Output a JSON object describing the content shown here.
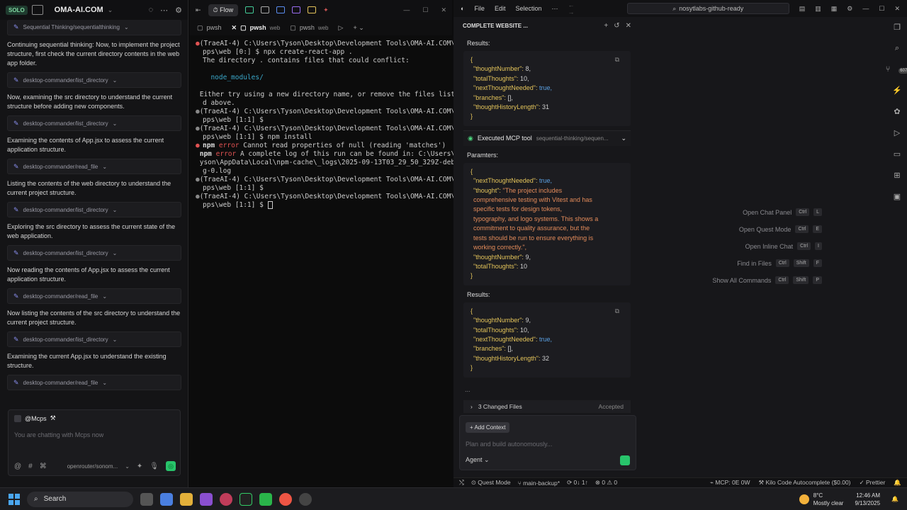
{
  "left": {
    "app_title": "OMA-AI.COM",
    "badge": "SOLO",
    "top_item": "Sequential Thinking/sequentialthinking",
    "entries": [
      {
        "text": "Continuing sequential thinking: Now, to implement the project structure, first check the current directory contents in the web app folder.",
        "tool": "desktop-commander/list_directory"
      },
      {
        "text": "Now, examining the src directory to understand the current structure before adding new components.",
        "tool": "desktop-commander/list_directory"
      },
      {
        "text": "Examining the contents of App.jsx to assess the current application structure.",
        "tool": "desktop-commander/read_file"
      },
      {
        "text": "Listing the contents of the web directory to understand the current project structure.",
        "tool": "desktop-commander/list_directory"
      },
      {
        "text": "Exploring the src directory to assess the current state of the web application.",
        "tool": "desktop-commander/list_directory"
      },
      {
        "text": "Now reading the contents of App.jsx to assess the current application structure.",
        "tool": "desktop-commander/read_file"
      },
      {
        "text": "Now listing the contents of the src directory to understand the current project structure.",
        "tool": "desktop-commander/list_directory"
      },
      {
        "text": "Examining the current App.jsx to understand the existing structure.",
        "tool": "desktop-commander/read_file"
      }
    ],
    "chat": {
      "mention": "@Mcps",
      "placeholder": "You are chatting with Mcps now",
      "model": "openrouter/sonom..."
    }
  },
  "terminal": {
    "flow_label": "Flow",
    "tabs": [
      {
        "name": "pwsh",
        "sub": ""
      },
      {
        "name": "pwsh",
        "sub": "web"
      },
      {
        "name": "pwsh",
        "sub": "web"
      }
    ],
    "lines": [
      {
        "dot": "red",
        "text": "(TraeAI-4) C:\\Users\\Tyson\\Desktop\\Development Tools\\OMA-AI.COM\\a"
      },
      {
        "dot": "",
        "text": "pps\\web [0:] $ npx create-react-app ."
      },
      {
        "dot": "",
        "text": "The directory . contains files that could conflict:"
      },
      {
        "dot": "",
        "text": ""
      },
      {
        "dot": "",
        "text": "  node_modules/",
        "cls": "cyan"
      },
      {
        "dot": "",
        "text": ""
      },
      {
        "dot": "",
        "text": "Either try using a new directory name, or remove the files liste"
      },
      {
        "dot": "",
        "text": "d above."
      },
      {
        "dot": "grey",
        "text": "(TraeAI-4) C:\\Users\\Tyson\\Desktop\\Development Tools\\OMA-AI.COM\\a"
      },
      {
        "dot": "",
        "text": "pps\\web [1:1] $"
      },
      {
        "dot": "grey",
        "text": "(TraeAI-4) C:\\Users\\Tyson\\Desktop\\Development Tools\\OMA-AI.COM\\a"
      },
      {
        "dot": "",
        "text": "pps\\web [1:1] $ npm install"
      },
      {
        "dot": "red",
        "text": "npm error Cannot read properties of null (reading 'matches')",
        "cls": "errline"
      },
      {
        "dot": "",
        "text": "npm error A complete log of this run can be found in: C:\\Users\\T",
        "cls": "errline"
      },
      {
        "dot": "",
        "text": "yson\\AppData\\Local\\npm-cache\\_logs\\2025-09-13T03_29_50_329Z-debu"
      },
      {
        "dot": "",
        "text": "g-0.log"
      },
      {
        "dot": "grey",
        "text": "(TraeAI-4) C:\\Users\\Tyson\\Desktop\\Development Tools\\OMA-AI.COM\\a"
      },
      {
        "dot": "",
        "text": "pps\\web [1:1] $"
      },
      {
        "dot": "grey",
        "text": "(TraeAI-4) C:\\Users\\Tyson\\Desktop\\Development Tools\\OMA-AI.COM\\a"
      },
      {
        "dot": "",
        "text": "pps\\web [1:1] $ ",
        "cursor": true
      }
    ]
  },
  "editor": {
    "menus": [
      "File",
      "Edit",
      "Selection",
      "···"
    ],
    "search": "nosytlabs-github-ready",
    "chat_title": "COMPLETE WEBSITE ...",
    "results_label": "Results:",
    "params_label": "Paramters:",
    "exec_label": "Executed MCP tool",
    "exec_tool": "sequential-thinking/sequen...",
    "changed_files": "3 Changed Files",
    "accepted": "Accepted",
    "add_context": "Add Context",
    "input_placeholder": "Plan and build autonomously...",
    "agent": "Agent",
    "ellipsis": "...",
    "results1": [
      [
        "\"thoughtNumber\": ",
        "8,",
        "num"
      ],
      [
        "\"totalThoughts\": ",
        "10,",
        "num"
      ],
      [
        "\"nextThoughtNeeded\": ",
        "true,",
        "bool"
      ],
      [
        "\"branches\": ",
        "[],",
        "num"
      ],
      [
        "\"thoughtHistoryLength\": ",
        "31",
        "num"
      ]
    ],
    "params": [
      [
        "\"nextThoughtNeeded\": ",
        "true,",
        "bool"
      ],
      [
        "\"thought\": ",
        "\"The project includes",
        "str"
      ],
      [
        "",
        "comprehensive testing with Vitest and has",
        "str"
      ],
      [
        "",
        "specific tests for design tokens,",
        "str"
      ],
      [
        "",
        "typography, and logo systems. This shows a",
        "str"
      ],
      [
        "",
        "commitment to quality assurance, but the",
        "str"
      ],
      [
        "",
        "tests should be run to ensure everything is",
        "str"
      ],
      [
        "",
        "working correctly.\",",
        "str"
      ],
      [
        "\"thoughtNumber\": ",
        "9,",
        "num"
      ],
      [
        "\"totalThoughts\": ",
        "10",
        "num"
      ]
    ],
    "results2": [
      [
        "\"thoughtNumber\": ",
        "9,",
        "num"
      ],
      [
        "\"totalThoughts\": ",
        "10,",
        "num"
      ],
      [
        "\"nextThoughtNeeded\": ",
        "true,",
        "bool"
      ],
      [
        "\"branches\": ",
        "[],",
        "num"
      ],
      [
        "\"thoughtHistoryLength\": ",
        "32",
        "num"
      ]
    ],
    "shortcuts": [
      {
        "label": "Open Chat Panel",
        "keys": [
          "Ctrl",
          "L"
        ]
      },
      {
        "label": "Open Quest Mode",
        "keys": [
          "Ctrl",
          "E"
        ]
      },
      {
        "label": "Open Inline Chat",
        "keys": [
          "Ctrl",
          "I"
        ]
      },
      {
        "label": "Find in Files",
        "keys": [
          "Ctrl",
          "Shift",
          "F"
        ]
      },
      {
        "label": "Show All Commands",
        "keys": [
          "Ctrl",
          "Shift",
          "P"
        ]
      }
    ],
    "activity_badge": "607",
    "status": {
      "quest": "Quest Mode",
      "branch": "main-backup*",
      "sync": "0↓ 1↑",
      "problems": "⊗ 0 ⚠ 0",
      "mcp": "MCP: 0E 0W",
      "kilo": "Kilo Code Autocomplete ($0.00)",
      "prettier": "Prettier"
    }
  },
  "taskbar": {
    "search": "Search",
    "temp": "8°C",
    "weather": "Mostly clear",
    "time": "12:46 AM",
    "date": "9/13/2025"
  }
}
